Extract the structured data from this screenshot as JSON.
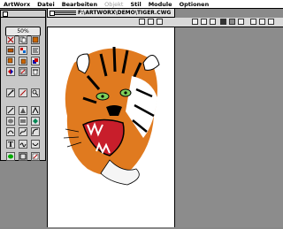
{
  "menubar": {
    "items": [
      {
        "label": "ArtWorx",
        "enabled": true
      },
      {
        "label": "Datei",
        "enabled": true
      },
      {
        "label": "Bearbeiten",
        "enabled": true
      },
      {
        "label": "Objekt",
        "enabled": false
      },
      {
        "label": "Stil",
        "enabled": true
      },
      {
        "label": "Module",
        "enabled": true
      },
      {
        "label": "Optionen",
        "enabled": true
      }
    ]
  },
  "palette": {
    "zoom_label": "50%"
  },
  "document": {
    "title": "F:\\ARTWORX\\DEMO\\TIGER.CWG"
  }
}
